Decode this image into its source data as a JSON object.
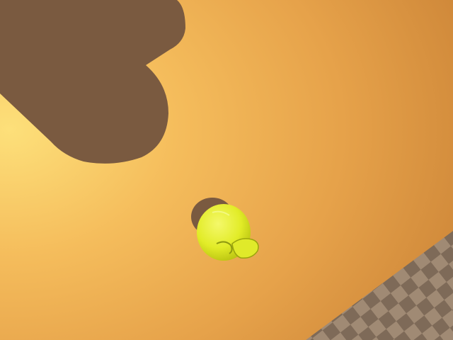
{
  "scene": {
    "objects": [
      {
        "name": "ground-plane",
        "color": "#e8a54c"
      },
      {
        "name": "robot-arm-shadow",
        "color": "#7a5a40"
      },
      {
        "name": "apple",
        "color": "#e6ef2a"
      },
      {
        "name": "checkered-floor",
        "color": "#8a7460"
      }
    ]
  }
}
